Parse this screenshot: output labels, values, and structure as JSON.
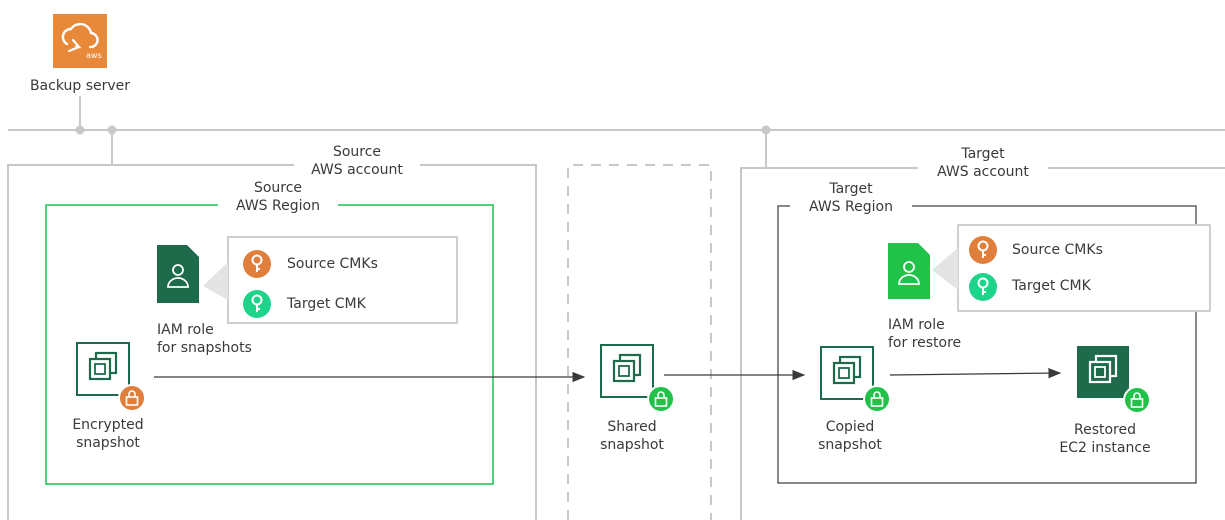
{
  "backup_server": {
    "label": "Backup server",
    "logo_text": "aws"
  },
  "source_account": {
    "line1": "Source",
    "line2": "AWS account"
  },
  "source_region": {
    "line1": "Source",
    "line2": "AWS Region"
  },
  "target_account": {
    "line1": "Target",
    "line2": "AWS account"
  },
  "target_region": {
    "line1": "Target",
    "line2": "AWS Region"
  },
  "source_keys": {
    "source_cmks": "Source CMKs",
    "target_cmk": "Target CMK"
  },
  "target_keys": {
    "source_cmks": "Source CMKs",
    "target_cmk": "Target CMK"
  },
  "iam_snapshots": {
    "line1": "IAM role",
    "line2": "for snapshots"
  },
  "iam_restore": {
    "line1": "IAM role",
    "line2": "for restore"
  },
  "encrypted_snapshot": {
    "line1": "Encrypted",
    "line2": "snapshot"
  },
  "shared_snapshot": {
    "line1": "Shared",
    "line2": "snapshot"
  },
  "copied_snapshot": {
    "line1": "Copied",
    "line2": "snapshot"
  },
  "restored_instance": {
    "line1": "Restored",
    "line2": "EC2 instance"
  },
  "colors": {
    "aws_orange": "#e8893a",
    "region_green": "#1fbf4f",
    "dark_green": "#1d6b4a",
    "bright_green": "#21c24a",
    "key_orange": "#e07f3c",
    "key_green": "#1ed38a",
    "frame_gray": "#c8c8c8"
  }
}
